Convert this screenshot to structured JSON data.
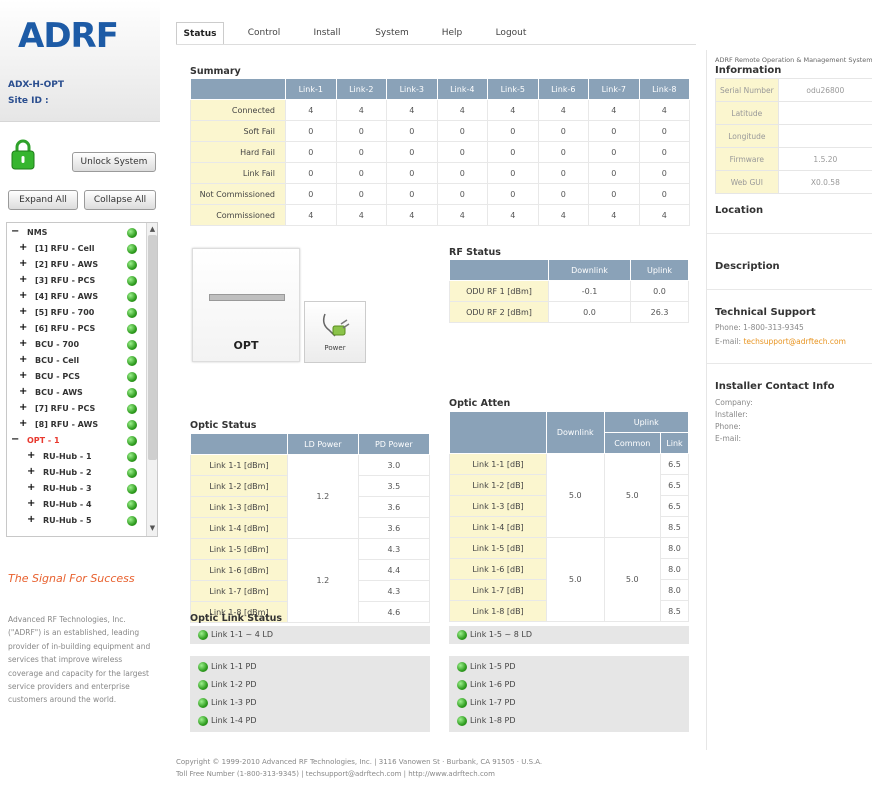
{
  "sidebar": {
    "logo": "ADRF",
    "device_name": "ADX-H-OPT",
    "site_id_label": "Site ID :",
    "unlock_label": "Unlock System",
    "expand_label": "Expand All",
    "collapse_label": "Collapse All",
    "tree": [
      {
        "pm": "−",
        "label": "NMS",
        "selected": false
      },
      {
        "pm": "+",
        "label": "[1] RFU - Cell",
        "selected": false
      },
      {
        "pm": "+",
        "label": "[2] RFU - AWS",
        "selected": false
      },
      {
        "pm": "+",
        "label": "[3] RFU - PCS",
        "selected": false
      },
      {
        "pm": "+",
        "label": "[4] RFU - AWS",
        "selected": false
      },
      {
        "pm": "+",
        "label": "[5] RFU - 700",
        "selected": false
      },
      {
        "pm": "+",
        "label": "[6] RFU - PCS",
        "selected": false
      },
      {
        "pm": "+",
        "label": "BCU - 700",
        "selected": false
      },
      {
        "pm": "+",
        "label": "BCU - Cell",
        "selected": false
      },
      {
        "pm": "+",
        "label": "BCU - PCS",
        "selected": false
      },
      {
        "pm": "+",
        "label": "BCU - AWS",
        "selected": false
      },
      {
        "pm": "+",
        "label": "[7] RFU - PCS",
        "selected": false
      },
      {
        "pm": "+",
        "label": "[8] RFU - AWS",
        "selected": false
      },
      {
        "pm": "−",
        "label": "OPT - 1",
        "selected": true
      },
      {
        "pm": "+",
        "label": "RU-Hub - 1",
        "selected": false
      },
      {
        "pm": "+",
        "label": "RU-Hub - 2",
        "selected": false
      },
      {
        "pm": "+",
        "label": "RU-Hub - 3",
        "selected": false
      },
      {
        "pm": "+",
        "label": "RU-Hub - 4",
        "selected": false
      },
      {
        "pm": "+",
        "label": "RU-Hub - 5",
        "selected": false
      }
    ],
    "slogan": "The Signal For Success",
    "about": "Advanced RF Technologies, Inc. (\"ADRF\") is an established, leading provider of in-building equipment and services that improve wireless coverage and capacity for the largest service providers and enterprise customers around the world."
  },
  "nav": {
    "tabs": [
      "Status",
      "Control",
      "Install",
      "System",
      "Help",
      "Logout"
    ],
    "active": "Status"
  },
  "summary": {
    "title": "Summary",
    "columns": [
      "Link-1",
      "Link-2",
      "Link-3",
      "Link-4",
      "Link-5",
      "Link-6",
      "Link-7",
      "Link-8"
    ],
    "rows": [
      {
        "label": "Connected",
        "values": [
          "4",
          "4",
          "4",
          "4",
          "4",
          "4",
          "4",
          "4"
        ]
      },
      {
        "label": "Soft Fail",
        "values": [
          "0",
          "0",
          "0",
          "0",
          "0",
          "0",
          "0",
          "0"
        ]
      },
      {
        "label": "Hard Fail",
        "values": [
          "0",
          "0",
          "0",
          "0",
          "0",
          "0",
          "0",
          "0"
        ]
      },
      {
        "label": "Link Fail",
        "values": [
          "0",
          "0",
          "0",
          "0",
          "0",
          "0",
          "0",
          "0"
        ]
      },
      {
        "label": "Not Commissioned",
        "values": [
          "0",
          "0",
          "0",
          "0",
          "0",
          "0",
          "0",
          "0"
        ]
      },
      {
        "label": "Commissioned",
        "values": [
          "4",
          "4",
          "4",
          "4",
          "4",
          "4",
          "4",
          "4"
        ]
      }
    ]
  },
  "device": {
    "label": "OPT",
    "power_label": "Power"
  },
  "rf_status": {
    "title": "RF Status",
    "columns": [
      "Downlink",
      "Uplink"
    ],
    "rows": [
      {
        "label": "ODU RF 1 [dBm]",
        "values": [
          "-0.1",
          "0.0"
        ]
      },
      {
        "label": "ODU RF 2 [dBm]",
        "values": [
          "0.0",
          "26.3"
        ]
      }
    ]
  },
  "optic_status": {
    "title": "Optic Status",
    "columns": [
      "LD Power",
      "PD Power"
    ],
    "rows": [
      {
        "label": "Link 1-1 [dBm]",
        "pd": "3.0"
      },
      {
        "label": "Link 1-2 [dBm]",
        "pd": "3.5"
      },
      {
        "label": "Link 1-3 [dBm]",
        "pd": "3.6"
      },
      {
        "label": "Link 1-4 [dBm]",
        "pd": "3.6"
      },
      {
        "label": "Link 1-5 [dBm]",
        "pd": "4.3"
      },
      {
        "label": "Link 1-6 [dBm]",
        "pd": "4.4"
      },
      {
        "label": "Link 1-7 [dBm]",
        "pd": "4.3"
      },
      {
        "label": "Link 1-8 [dBm]",
        "pd": "4.6"
      }
    ],
    "ld_groups": [
      "1.2",
      "1.2"
    ]
  },
  "optic_atten": {
    "title": "Optic Atten",
    "col_downlink": "Downlink",
    "col_uplink": "Uplink",
    "col_common": "Common",
    "col_link": "Link",
    "rows": [
      {
        "label": "Link 1-1 [dB]",
        "link": "6.5"
      },
      {
        "label": "Link 1-2 [dB]",
        "link": "6.5"
      },
      {
        "label": "Link 1-3 [dB]",
        "link": "6.5"
      },
      {
        "label": "Link 1-4 [dB]",
        "link": "8.5"
      },
      {
        "label": "Link 1-5 [dB]",
        "link": "8.0"
      },
      {
        "label": "Link 1-6 [dB]",
        "link": "8.0"
      },
      {
        "label": "Link 1-7 [dB]",
        "link": "8.0"
      },
      {
        "label": "Link 1-8 [dB]",
        "link": "8.5"
      }
    ],
    "groups": [
      {
        "downlink": "5.0",
        "common": "5.0"
      },
      {
        "downlink": "5.0",
        "common": "5.0"
      }
    ]
  },
  "optic_link_status": {
    "title": "Optic Link Status",
    "ld_left": "Link 1-1 ~ 4 LD",
    "ld_right": "Link 1-5 ~ 8 LD",
    "pd_left": [
      "Link 1-1 PD",
      "Link 1-2 PD",
      "Link 1-3 PD",
      "Link 1-4 PD"
    ],
    "pd_right": [
      "Link 1-5 PD",
      "Link 1-6 PD",
      "Link 1-7 PD",
      "Link 1-8 PD"
    ]
  },
  "right_panel": {
    "system_name": "ADRF Remote Operation & Management System",
    "info_title": "Information",
    "info": [
      {
        "key": "Serial Number",
        "value": "odu26800"
      },
      {
        "key": "Latitude",
        "value": ""
      },
      {
        "key": "Longitude",
        "value": ""
      },
      {
        "key": "Firmware",
        "value": "1.5.20"
      },
      {
        "key": "Web GUI",
        "value": "X0.0.58"
      }
    ],
    "location_title": "Location",
    "description_title": "Description",
    "tech_title": "Technical Support",
    "tech_phone": "Phone: 1-800-313-9345",
    "tech_email_label": "E-mail: ",
    "tech_email": "techsupport@adrftech.com",
    "installer_title": "Installer Contact Info",
    "installer_fields": [
      "Company:",
      "Installer:",
      "Phone:",
      "E-mail:"
    ]
  },
  "footer": {
    "line1": "Copyright © 1999-2010 Advanced RF Technologies, Inc. | 3116 Vanowen St · Burbank, CA 91505 · U.S.A.",
    "line2": "Toll Free Number (1-800-313-9345) | techsupport@adrftech.com | http://www.adrftech.com"
  }
}
